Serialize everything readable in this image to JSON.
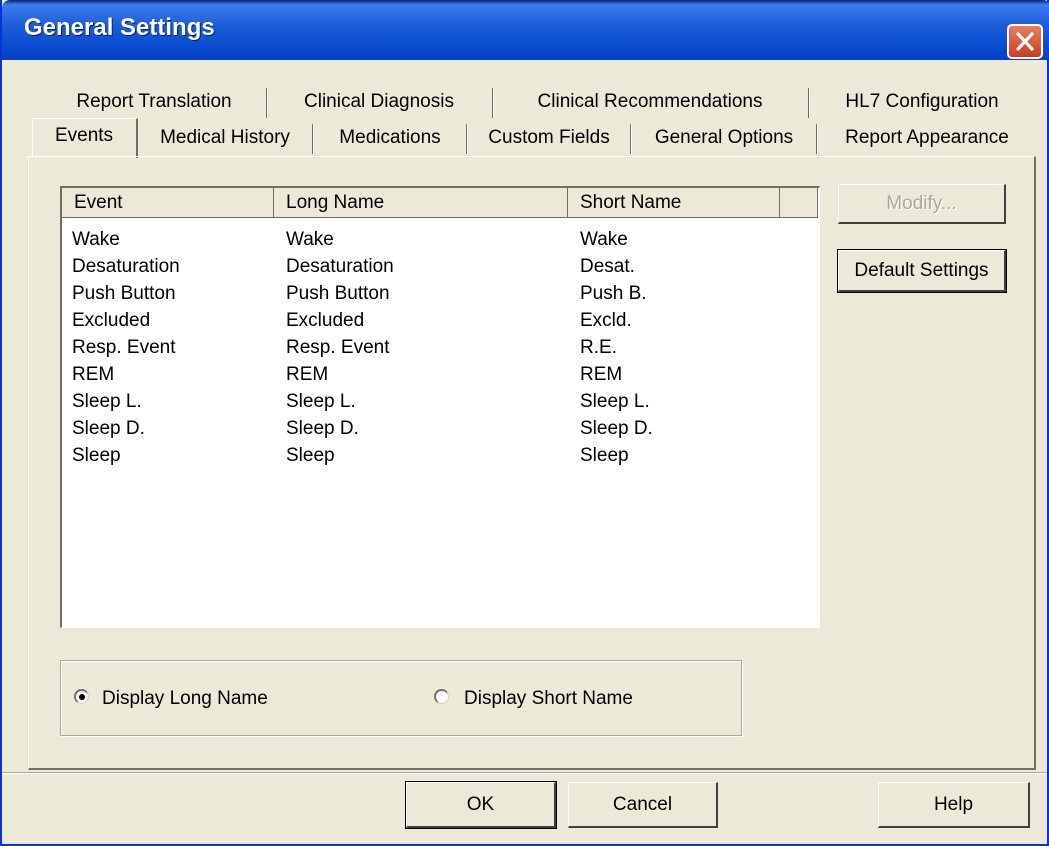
{
  "window": {
    "title": "General Settings"
  },
  "tabs": {
    "row1": [
      "Report Translation",
      "Clinical Diagnosis",
      "Clinical Recommendations",
      "HL7 Configuration"
    ],
    "row2": [
      "Events",
      "Medical History",
      "Medications",
      "Custom Fields",
      "General Options",
      "Report Appearance"
    ],
    "active": "Events"
  },
  "list": {
    "columns": [
      "Event",
      "Long Name",
      "Short Name"
    ],
    "rows": [
      [
        "Wake",
        "Wake",
        "Wake"
      ],
      [
        "Desaturation",
        "Desaturation",
        "Desat."
      ],
      [
        "Push Button",
        "Push Button",
        "Push B."
      ],
      [
        "Excluded",
        "Excluded",
        "Excld."
      ],
      [
        "Resp. Event",
        "Resp. Event",
        "R.E."
      ],
      [
        "REM",
        "REM",
        "REM"
      ],
      [
        "Sleep L.",
        "Sleep L.",
        "Sleep L."
      ],
      [
        "Sleep D.",
        "Sleep D.",
        "Sleep D."
      ],
      [
        "Sleep",
        "Sleep",
        "Sleep"
      ]
    ]
  },
  "side_buttons": {
    "modify": "Modify...",
    "default_settings": "Default Settings"
  },
  "display_options": {
    "long": "Display Long Name",
    "short": "Display Short Name",
    "selected": "long"
  },
  "footer": {
    "ok": "OK",
    "cancel": "Cancel",
    "help": "Help"
  },
  "colors": {
    "titlebar": "#0b4fd2",
    "dialog_bg": "#ece9d8",
    "close": "#d6512e"
  }
}
